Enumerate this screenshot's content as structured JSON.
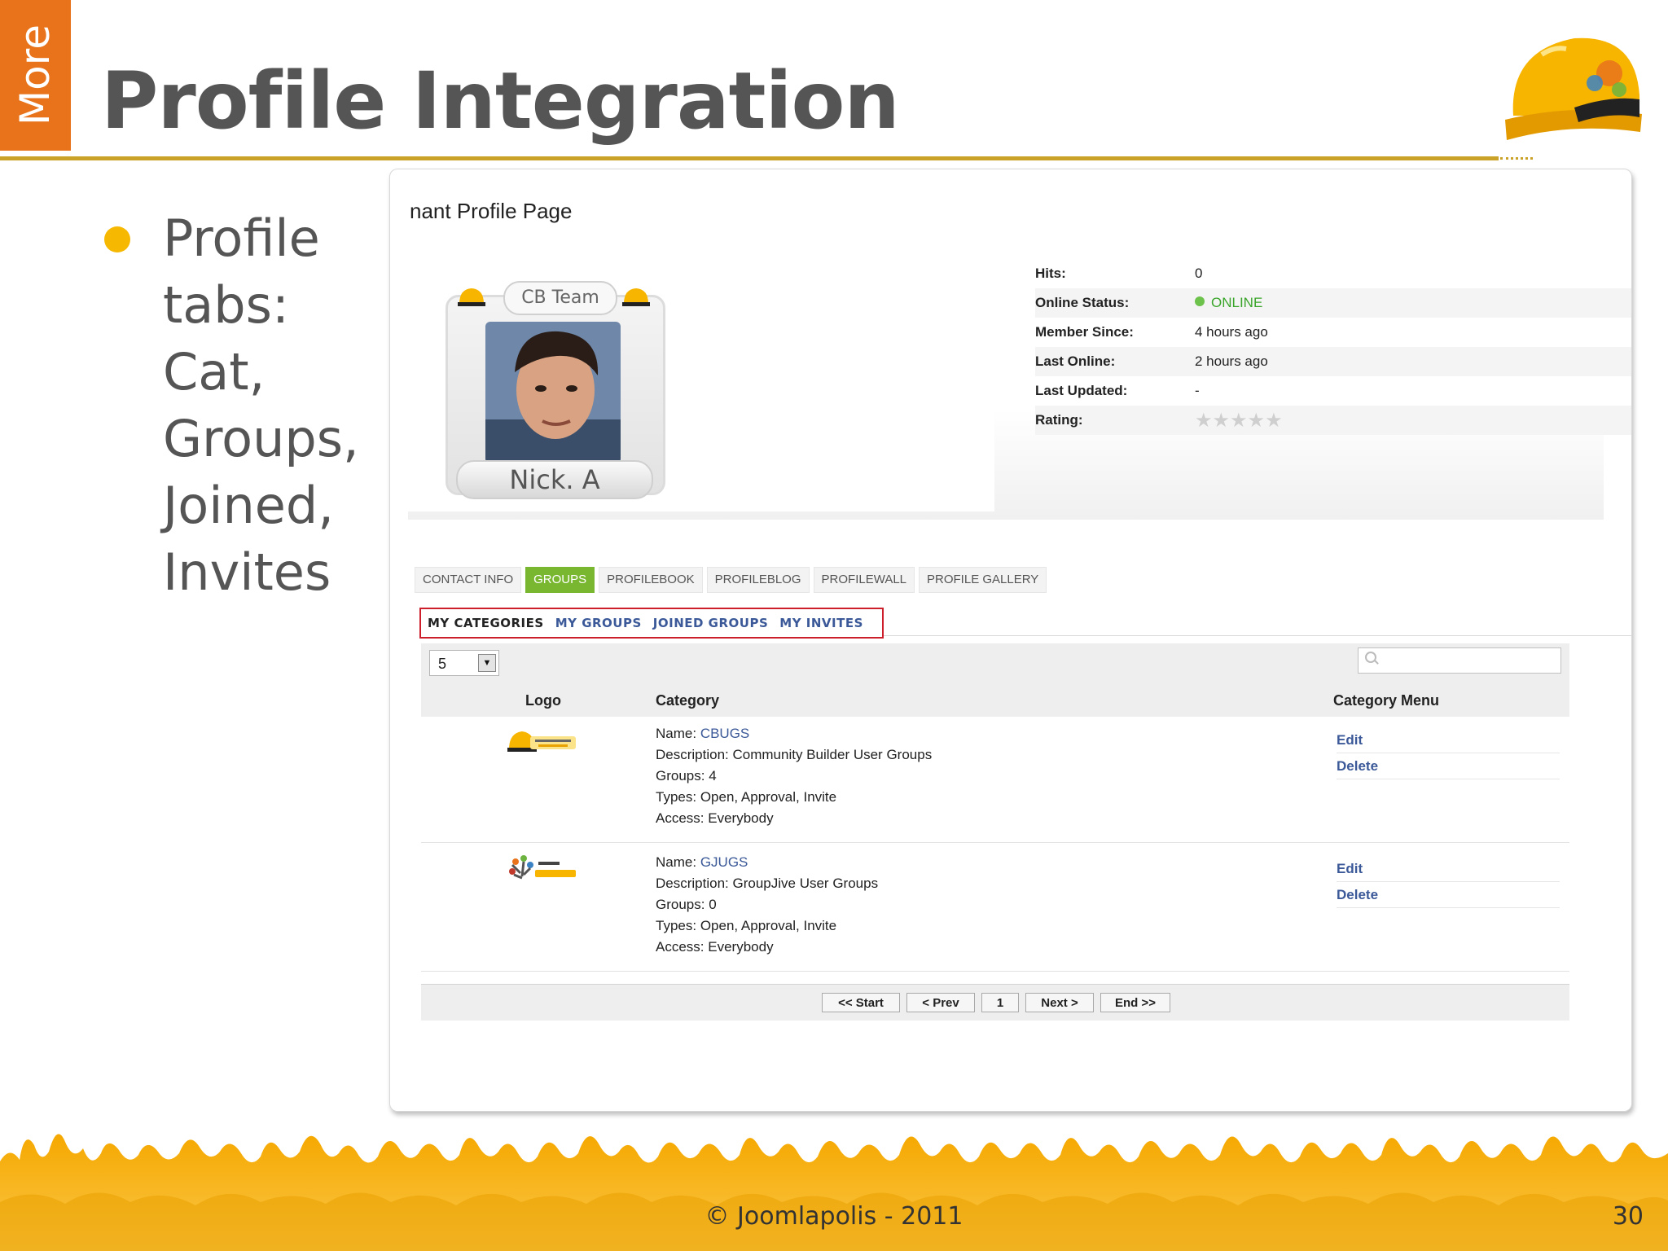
{
  "slide": {
    "side_tab": "More",
    "title": "Profile Integration",
    "bullet": "Profile tabs: Cat, Groups, Joined, Invites",
    "footer": "© Joomlapolis - 2011",
    "page_number": "30"
  },
  "profile": {
    "page_title": "nant Profile Page",
    "badge": "CB Team",
    "name": "Nick. A",
    "info": [
      {
        "label": "Hits:",
        "value": "0"
      },
      {
        "label": "Online Status:",
        "value": "ONLINE"
      },
      {
        "label": "Member Since:",
        "value": "4 hours ago"
      },
      {
        "label": "Last Online:",
        "value": "2 hours ago"
      },
      {
        "label": "Last Updated:",
        "value": "-"
      },
      {
        "label": "Rating:",
        "value": "0 of 5 stars"
      }
    ]
  },
  "tabs": [
    "CONTACT INFO",
    "GROUPS",
    "PROFILEBOOK",
    "PROFILEBLOG",
    "PROFILEWALL",
    "PROFILE GALLERY"
  ],
  "subtabs": [
    "MY CATEGORIES",
    "MY GROUPS",
    "JOINED GROUPS",
    "MY INVITES"
  ],
  "list": {
    "page_size": "5",
    "columns": {
      "logo": "Logo",
      "category": "Category",
      "menu": "Category Menu"
    },
    "rows": [
      {
        "name_label": "Name:",
        "name": "CBUGS",
        "description_label": "Description:",
        "description": "Community Builder User Groups",
        "groups_label": "Groups:",
        "groups": "4",
        "types_label": "Types:",
        "types": "Open, Approval, Invite",
        "access_label": "Access:",
        "access": "Everybody",
        "edit": "Edit",
        "delete": "Delete"
      },
      {
        "name_label": "Name:",
        "name": "GJUGS",
        "description_label": "Description:",
        "description": "GroupJive User Groups",
        "groups_label": "Groups:",
        "groups": "0",
        "types_label": "Types:",
        "types": "Open, Approval, Invite",
        "access_label": "Access:",
        "access": "Everybody",
        "edit": "Edit",
        "delete": "Delete"
      }
    ],
    "pager": [
      "<< Start",
      "< Prev",
      "1",
      "Next >",
      "End >>"
    ]
  },
  "colors": {
    "orange": "#e8731b",
    "gold": "#f6b800",
    "green_tab": "#7ab730",
    "link": "#3b5998",
    "highlight": "#cc1f2b"
  }
}
